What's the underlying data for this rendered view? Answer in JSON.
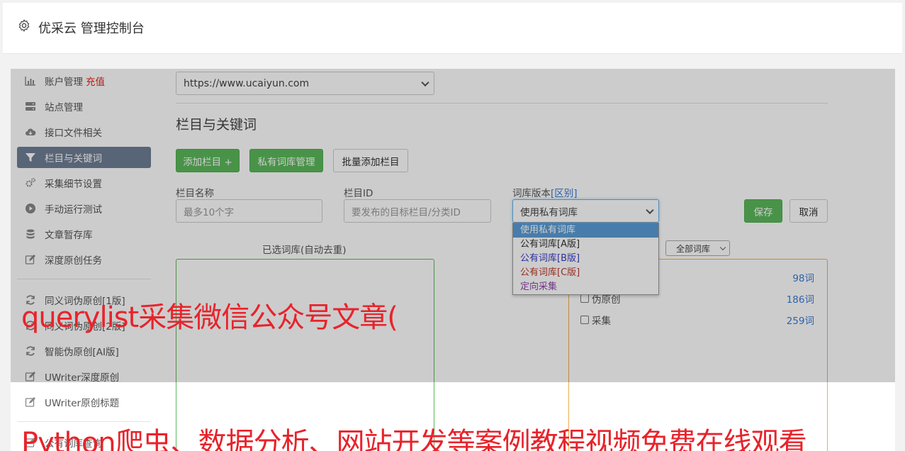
{
  "header": {
    "title": "优采云 管理控制台",
    "icon": "gear-icon"
  },
  "sidebar": {
    "items": [
      {
        "label": "账户管理",
        "badge": "充值",
        "icon": "bar-chart-icon"
      },
      {
        "label": "站点管理",
        "icon": "server-icon"
      },
      {
        "label": "接口文件相关",
        "icon": "cloud-download-icon"
      },
      {
        "label": "栏目与关键词",
        "icon": "filter-icon",
        "active": true
      },
      {
        "label": "采集细节设置",
        "icon": "gears-icon"
      },
      {
        "label": "手动运行测试",
        "icon": "play-circle-icon"
      },
      {
        "label": "文章暂存库",
        "icon": "database-icon"
      },
      {
        "label": "深度原创任务",
        "icon": "edit-icon"
      },
      {
        "label": "同义词伪原创[1版]",
        "icon": "refresh-icon"
      },
      {
        "label": "同义词伪原创[2版]",
        "icon": "refresh-icon"
      },
      {
        "label": "智能伪原创[AI版]",
        "icon": "refresh-icon"
      },
      {
        "label": "UWriter深度原创",
        "icon": "edit-icon"
      },
      {
        "label": "UWriter原创标题",
        "icon": "edit-icon"
      },
      {
        "label": "公有词库查询",
        "icon": "edit-icon"
      }
    ]
  },
  "main": {
    "site_select": {
      "value": "https://www.ucaiyun.com"
    },
    "section_title": "栏目与关键词",
    "buttons": {
      "add_column": "添加栏目 +",
      "private_lib": "私有词库管理",
      "batch_add": "批量添加栏目",
      "save": "保存",
      "cancel": "取消"
    },
    "form": {
      "column_name_label": "栏目名称",
      "column_name_placeholder": "最多10个字",
      "column_id_label": "栏目ID",
      "column_id_placeholder": "要发布的目标栏目/分类ID",
      "lib_version_label": "词库版本",
      "lib_version_link": "[区别]",
      "lib_version_value": "使用私有词库"
    },
    "dropdown": {
      "options": [
        {
          "label": "使用私有词库",
          "selected": true,
          "color": "#ffffff"
        },
        {
          "label": "公有词库[A版]",
          "color": "#333333"
        },
        {
          "label": "公有词库[B版]",
          "color": "#3a3acb"
        },
        {
          "label": "公有词库[C版]",
          "color": "#c0392b"
        },
        {
          "label": "定向采集",
          "color": "#8e44ad"
        }
      ]
    },
    "selected_panel_title": "已选词库(自动去重)",
    "filter_select": {
      "value": "全部词库"
    },
    "libraries": [
      {
        "name": "",
        "count": "98词"
      },
      {
        "name": "伪原创",
        "count": "186词"
      },
      {
        "name": "采集",
        "count": "259词"
      }
    ]
  },
  "watermarks": {
    "line1": "querylist采集微信公众号文章(",
    "line2": "Python爬虫、数据分析、网站开发等案例教程视频免费在线观看"
  },
  "colors": {
    "accent_green": "#5cb85c",
    "active_nav": "#6f7f94",
    "badge_red": "#e2231a",
    "link_blue": "#3a7bd5"
  }
}
